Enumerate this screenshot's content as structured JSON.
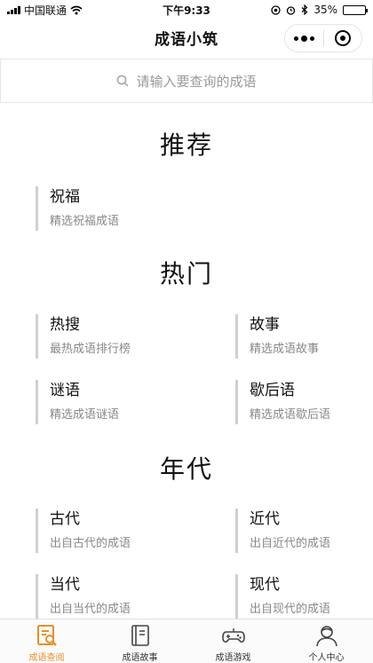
{
  "status_bar": {
    "carrier": "中国联通",
    "time": "下午9:33",
    "battery": "35%",
    "battery_level": 0.35
  },
  "nav": {
    "title": "成语小筑"
  },
  "search": {
    "placeholder": "请输入要查询的成语"
  },
  "sections": {
    "recommend": {
      "title": "推荐",
      "items": [
        {
          "title": "祝福",
          "subtitle": "精选祝福成语"
        }
      ]
    },
    "hot": {
      "title": "热门",
      "items": [
        {
          "title": "热搜",
          "subtitle": "最热成语排行榜"
        },
        {
          "title": "故事",
          "subtitle": "精选成语故事"
        },
        {
          "title": "谜语",
          "subtitle": "精选成语谜语"
        },
        {
          "title": "歇后语",
          "subtitle": "精选成语歇后语"
        }
      ]
    },
    "era": {
      "title": "年代",
      "items": [
        {
          "title": "古代",
          "subtitle": "出自古代的成语"
        },
        {
          "title": "近代",
          "subtitle": "出自近代的成语"
        },
        {
          "title": "当代",
          "subtitle": "出自当代的成语"
        },
        {
          "title": "现代",
          "subtitle": "出自现代的成语"
        }
      ]
    }
  },
  "tab_bar": {
    "active_color": "#e8902a",
    "tabs": [
      {
        "label": "成语查阅",
        "icon": "search-book-icon"
      },
      {
        "label": "成语故事",
        "icon": "book-icon"
      },
      {
        "label": "成语游戏",
        "icon": "gamepad-icon"
      },
      {
        "label": "个人中心",
        "icon": "user-icon"
      }
    ]
  }
}
